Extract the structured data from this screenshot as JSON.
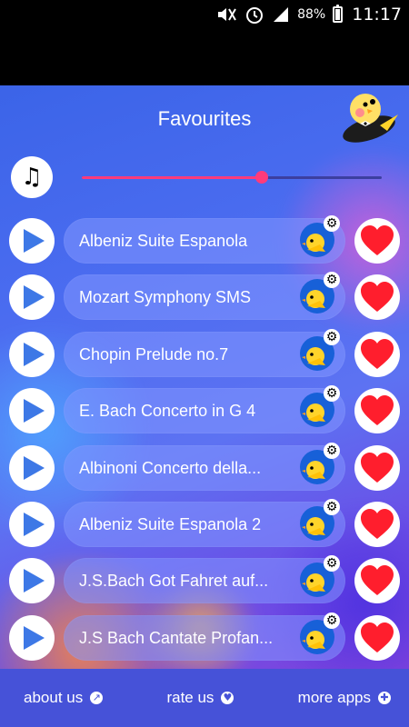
{
  "status_bar": {
    "battery": "88%",
    "time": "11:17",
    "icons": [
      "mute-icon",
      "alarm-icon",
      "signal-icon",
      "battery-icon"
    ]
  },
  "header": {
    "title": "Favourites",
    "mascot_icon": "bird-mascot-icon"
  },
  "player": {
    "icon": "music-note-icon",
    "glyph": "♫",
    "progress_fraction": 0.6
  },
  "tracks": [
    {
      "title": "Albeniz Suite Espanola"
    },
    {
      "title": "Mozart Symphony SMS"
    },
    {
      "title": "Chopin Prelude no.7"
    },
    {
      "title": "E. Bach Concerto in G 4"
    },
    {
      "title": "Albinoni Concerto della..."
    },
    {
      "title": "Albeniz Suite Espanola 2"
    },
    {
      "title": "J.S.Bach Got Fahret auf..."
    },
    {
      "title": "J.S Bach Cantate Profan..."
    }
  ],
  "colors": {
    "play_triangle": "#3d78e6",
    "heart": "#ff1e2d",
    "slider": "#ff3b7a",
    "bottom_bar": "#4652d8"
  },
  "bottom_bar": {
    "about": "about us",
    "rate": "rate us",
    "more": "more apps"
  }
}
